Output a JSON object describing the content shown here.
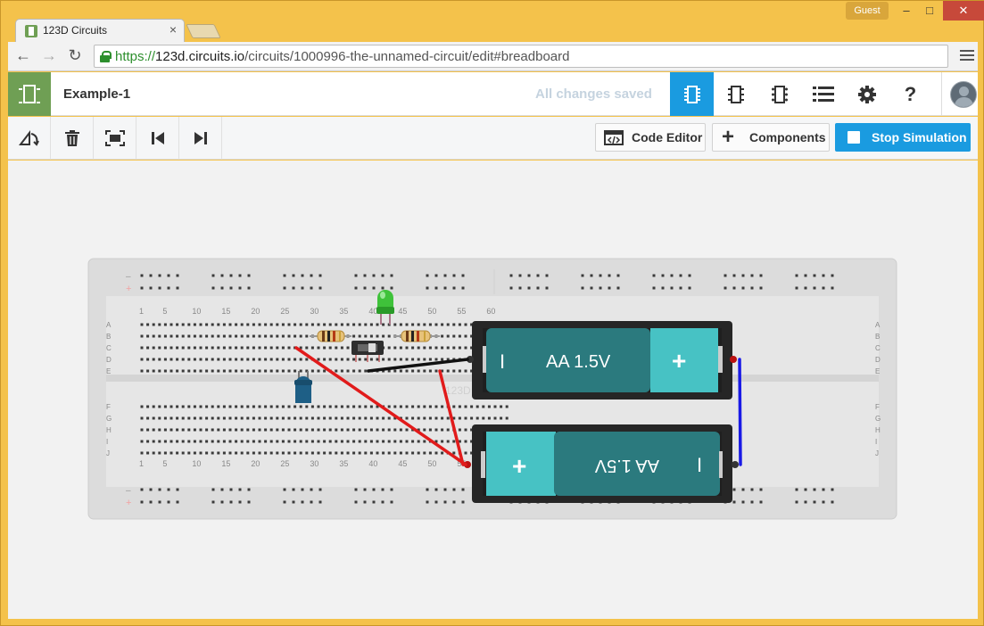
{
  "browser": {
    "tab_title": "123D Circuits",
    "tab_close": "×",
    "profile_label": "Guest",
    "window_min": "–",
    "window_max": "□",
    "window_close": "✕",
    "url_scheme": "https://",
    "url_host": "123d.circuits.io",
    "url_path": "/circuits/1000996-the-unnamed-circuit/edit#breadboard",
    "back": "←",
    "forward": "→",
    "reload": "↻"
  },
  "header": {
    "project_name": "Example-1",
    "save_status": "All changes saved",
    "views": [
      {
        "name": "breadboard-view",
        "active": true
      },
      {
        "name": "schematic-view",
        "active": false
      },
      {
        "name": "pcb-view",
        "active": false
      },
      {
        "name": "components-list-view",
        "active": false
      }
    ],
    "settings_icon": "gear-icon",
    "help_label": "?"
  },
  "toolbar": {
    "code_editor_label": "Code Editor",
    "code_editor_icon": "</>",
    "components_label": "Components",
    "components_icon": "+",
    "simulation_label": "Stop Simulation"
  },
  "breadboard": {
    "column_labels": [
      "1",
      "5",
      "10",
      "15",
      "20",
      "25",
      "30",
      "35",
      "40",
      "45",
      "50",
      "55",
      "60"
    ],
    "row_labels_top": [
      "A",
      "B",
      "C",
      "D",
      "E"
    ],
    "row_labels_bottom": [
      "F",
      "G",
      "H",
      "I",
      "J"
    ],
    "rail_minus": "–",
    "rail_plus": "+",
    "watermark": "123D"
  },
  "components": {
    "battery_top_label": "AA 1.5V",
    "battery_bottom_label": "AA 1.5V",
    "battery_plus": "+",
    "battery_minus": "I"
  },
  "colors": {
    "accent": "#1a9be0",
    "brand_green": "#6f9f54",
    "battery_body": "#2b7a7e",
    "battery_cap": "#47c2c4",
    "wire_red": "#e11b1b",
    "wire_blue": "#1a1ae6",
    "wire_black": "#111111",
    "led_green": "#3fc23a",
    "led_blue": "#1e5f86"
  }
}
